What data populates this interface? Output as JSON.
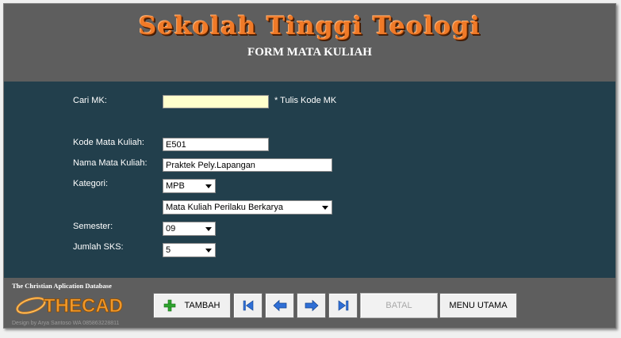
{
  "header": {
    "college_name": "Sekolah Tinggi Teologi",
    "form_title": "FORM MATA KULIAH"
  },
  "form": {
    "search_label": "Cari MK:",
    "search_value": "",
    "search_hint": "* Tulis Kode MK",
    "kode_label": "Kode Mata Kuliah:",
    "kode_value": "E501",
    "nama_label": "Nama Mata Kuliah:",
    "nama_value": "Praktek Pely.Lapangan",
    "kategori_label": "Kategori:",
    "kategori_value": "MPB",
    "kategori_desc_value": "Mata Kuliah Perilaku Berkarya",
    "semester_label": "Semester:",
    "semester_value": "09",
    "sks_label": "Jumlah SKS:",
    "sks_value": "5"
  },
  "footer": {
    "tagline": "The Christian Aplication Database",
    "logo_text": "THECAD",
    "design_credit": "Design by Arya Santoso WA 085863228811"
  },
  "buttons": {
    "tambah": "TAMBAH",
    "batal": "BATAL",
    "menu_utama": "MENU UTAMA"
  },
  "colors": {
    "header_bg": "#5e5e5e",
    "panel_bg": "#223f4c",
    "title_orange": "#f07a28",
    "search_bg": "#ffffcc",
    "nav_blue": "#2f6fd6",
    "add_green": "#2fa52f"
  },
  "icons": {
    "add": "plus-icon",
    "first": "first-record-icon",
    "prev": "prev-arrow-icon",
    "next": "next-arrow-icon",
    "last": "last-record-icon"
  }
}
